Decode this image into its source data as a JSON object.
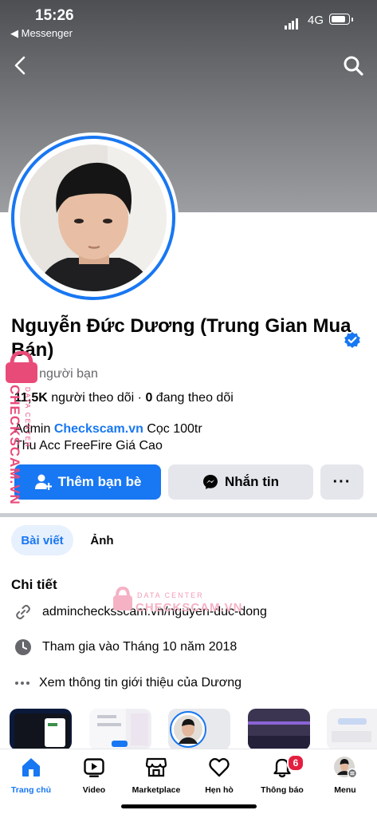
{
  "status_bar": {
    "time": "15:26",
    "back_app": "◀ Messenger",
    "network": "4G"
  },
  "profile": {
    "name": "Nguyễn Đức Dương (Trung Gian Mua Bán)",
    "friends_count": "138",
    "friends_label": "người bạn",
    "followers_count": "11,5K",
    "followers_label": "người theo dõi",
    "separator": "·",
    "following_count": "0",
    "following_label": "đang theo dõi",
    "bio_prefix": "Admin",
    "bio_link": "Checkscam.vn",
    "bio_suffix": "Cọc 100tr",
    "bio_line2": "Thu Acc FreeFire Giá Cao"
  },
  "actions": {
    "add_friend": "Thêm bạn bè",
    "message": "Nhắn tin",
    "more": "···"
  },
  "tabs": [
    {
      "label": "Bài viết",
      "active": true
    },
    {
      "label": "Ảnh",
      "active": false
    }
  ],
  "details": {
    "title": "Chi tiết",
    "website": "adminchecksscam.vn/nguyen-duc-dong",
    "joined": "Tham gia vào Tháng 10 năm 2018",
    "about": "Xem thông tin giới thiệu của Dương"
  },
  "bottom_nav": [
    {
      "label": "Trang chủ",
      "icon": "home-icon",
      "active": true
    },
    {
      "label": "Video",
      "icon": "video-icon"
    },
    {
      "label": "Marketplace",
      "icon": "marketplace-icon"
    },
    {
      "label": "Hẹn hò",
      "icon": "dating-heart-icon"
    },
    {
      "label": "Thông báo",
      "icon": "bell-icon",
      "badge": "6"
    },
    {
      "label": "Menu",
      "icon": "menu-avatar-icon"
    }
  ],
  "watermark": {
    "top": "DATA CENTER",
    "brand": "CHECKSCAM.VN"
  },
  "colors": {
    "accent": "#1877f2",
    "badge": "#e41e3f",
    "watermark": "#e94b79"
  }
}
